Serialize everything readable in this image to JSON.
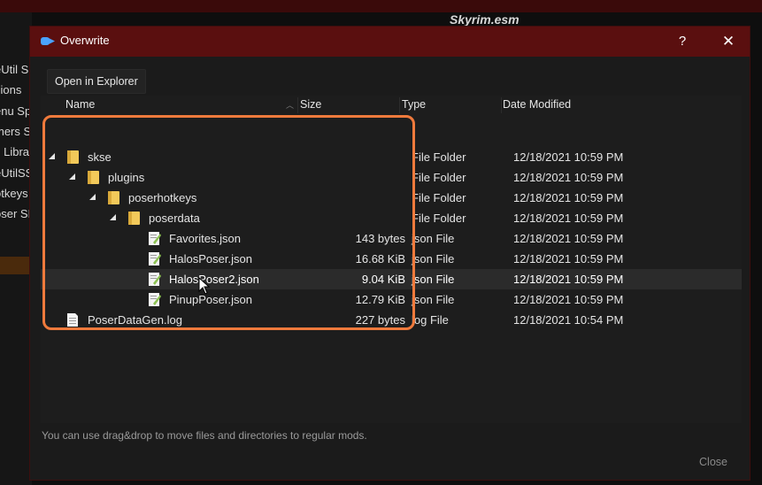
{
  "background": {
    "title": "Skyrim.esm",
    "left_items": [
      "eUtil S",
      "sions",
      "enu Sp",
      "mers S",
      "s Libra",
      "eUtilSS",
      "otkeys",
      "oser SE"
    ]
  },
  "dialog": {
    "title": "Overwrite",
    "help_label": "?",
    "close_glyph": "✕",
    "open_explorer_label": "Open in Explorer",
    "columns": {
      "name": "Name",
      "size": "Size",
      "type": "Type",
      "date": "Date Modified"
    },
    "rows": [
      {
        "name": "skse",
        "size": "",
        "type": "File Folder",
        "date": "12/18/2021 10:59 PM",
        "kind": "folder",
        "depth": 0,
        "expanded": true
      },
      {
        "name": "plugins",
        "size": "",
        "type": "File Folder",
        "date": "12/18/2021 10:59 PM",
        "kind": "folder",
        "depth": 1,
        "expanded": true
      },
      {
        "name": "poserhotkeys",
        "size": "",
        "type": "File Folder",
        "date": "12/18/2021 10:59 PM",
        "kind": "folder",
        "depth": 2,
        "expanded": true
      },
      {
        "name": "poserdata",
        "size": "",
        "type": "File Folder",
        "date": "12/18/2021 10:59 PM",
        "kind": "folder",
        "depth": 3,
        "expanded": true
      },
      {
        "name": "Favorites.json",
        "size": "143 bytes",
        "type": "json File",
        "date": "12/18/2021 10:59 PM",
        "kind": "json",
        "depth": 4
      },
      {
        "name": "HalosPoser.json",
        "size": "16.68 KiB",
        "type": "json File",
        "date": "12/18/2021 10:59 PM",
        "kind": "json",
        "depth": 4
      },
      {
        "name": "HalosPoser2.json",
        "size": "9.04 KiB",
        "type": "json File",
        "date": "12/18/2021 10:59 PM",
        "kind": "json",
        "depth": 4,
        "highlighted": true
      },
      {
        "name": "PinupPoser.json",
        "size": "12.79 KiB",
        "type": "json File",
        "date": "12/18/2021 10:59 PM",
        "kind": "json",
        "depth": 4
      },
      {
        "name": "PoserDataGen.log",
        "size": "227 bytes",
        "type": "log File",
        "date": "12/18/2021 10:54 PM",
        "kind": "log",
        "depth": 0
      }
    ],
    "hint": "You can use drag&drop to move files and directories to regular mods.",
    "close_label": "Close"
  },
  "colors": {
    "titlebar": "#5a0f0f",
    "annotation": "#f07a3c",
    "folder": "#f2c95a",
    "json_icon": "#8cc152"
  },
  "icons": {
    "app": "mo2-app-icon",
    "folder": "folder-icon",
    "json": "json-file-icon",
    "log": "log-file-icon",
    "expander": "expand-triangle-icon"
  }
}
